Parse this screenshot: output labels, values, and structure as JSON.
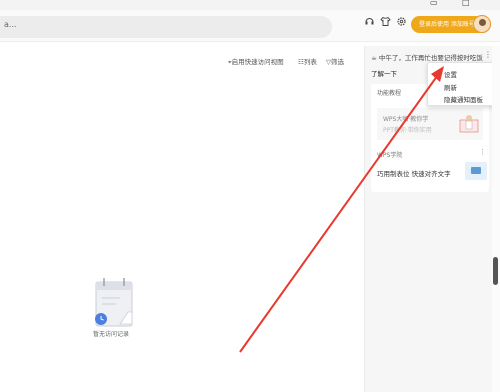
{
  "header": {
    "search_placeholder": "a...",
    "signin_label": "登录后使用 添加账号",
    "icons": [
      "headset-icon",
      "tshirt-icon",
      "settings-icon"
    ]
  },
  "toolbar": {
    "items": [
      "启用快速访问视图",
      "列表",
      "筛选"
    ]
  },
  "right_panel": {
    "greeting": "中午了，工作再忙也要记得按时吃饭",
    "learn_more": "了解一下",
    "card": {
      "title": "功能教程",
      "line1": "WPS大咖·教你学",
      "line2": "PPT教你·带你实用"
    },
    "card2": {
      "title": "WPS学院",
      "text": "巧用制表位 快速对齐文字"
    }
  },
  "menu": {
    "items": [
      "设置",
      "刷新",
      "隐藏通知面板"
    ]
  },
  "empty_state": {
    "caption": "暂无访问记录"
  },
  "colors": {
    "accent": "#f0a81b",
    "arrow": "#e8392c"
  }
}
